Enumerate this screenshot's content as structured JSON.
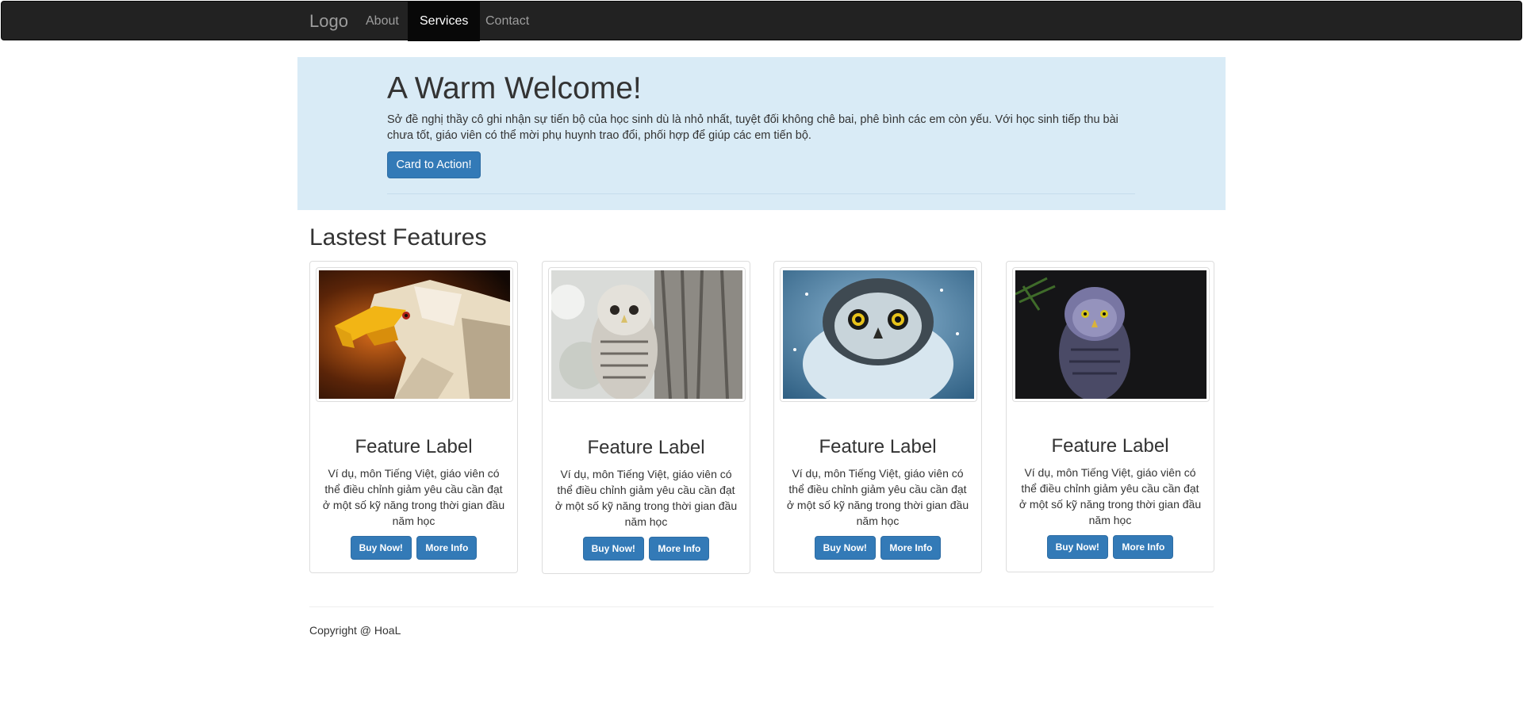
{
  "navbar": {
    "brand": "Logo",
    "items": [
      {
        "label": "About",
        "active": false
      },
      {
        "label": "Services",
        "active": true
      },
      {
        "label": "Contact",
        "active": false
      }
    ]
  },
  "jumbotron": {
    "title": "A Warm Welcome!",
    "text": "Sở đề nghị thầy cô ghi nhận sự tiến bộ của học sinh dù là nhỏ nhất, tuyệt đối không chê bai, phê bình các em còn yếu. Với học sinh tiếp thu bài chưa tốt, giáo viên có thể mời phụ huynh trao đổi, phối hợp để giúp các em tiến bộ.",
    "button": "Card to Action!"
  },
  "features": {
    "title": "Lastest Features",
    "cards": [
      {
        "image": "eagle-image",
        "label": "Feature Label",
        "text": "Ví dụ, môn Tiếng Việt, giáo viên có thể điều chỉnh giảm yêu cầu cần đạt ở một số kỹ năng trong thời gian đầu năm học",
        "buy": "Buy Now!",
        "more": "More Info"
      },
      {
        "image": "owl-tree-image",
        "label": "Feature Label",
        "text": "Ví dụ, môn Tiếng Việt, giáo viên có thể điều chỉnh giảm yêu cầu cần đạt ở một số kỹ năng trong thời gian đầu năm học",
        "buy": "Buy Now!",
        "more": "More Info"
      },
      {
        "image": "snowy-owl-image",
        "label": "Feature Label",
        "text": "Ví dụ, môn Tiếng Việt, giáo viên có thể điều chỉnh giảm yêu cầu cần đạt ở một số kỹ năng trong thời gian đầu năm học",
        "buy": "Buy Now!",
        "more": "More Info"
      },
      {
        "image": "dark-owl-image",
        "label": "Feature Label",
        "text": "Ví dụ, môn Tiếng Việt, giáo viên có thể điều chỉnh giảm yêu cầu cần đạt ở một số kỹ năng trong thời gian đầu năm học",
        "buy": "Buy Now!",
        "more": "More Info"
      }
    ]
  },
  "footer": {
    "text": "Copyright @ HoaL"
  },
  "colors": {
    "navbar_bg": "#222222",
    "jumbotron_bg": "#d9ebf6",
    "primary": "#337ab7"
  }
}
